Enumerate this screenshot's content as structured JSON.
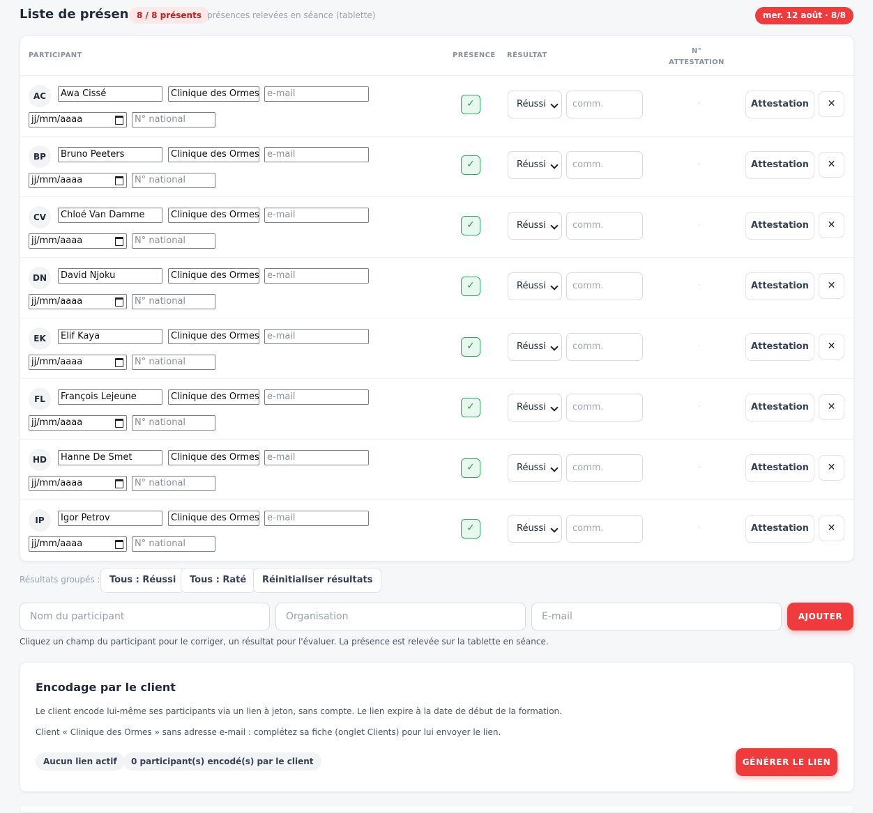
{
  "header": {
    "title": "Liste de présence",
    "count_badge": "8 / 8 présents",
    "subtitle": "présences relevées en séance (tablette)",
    "date_pill": "mer. 12 août · 8/8"
  },
  "table": {
    "columns": {
      "participant": "PARTICIPANT",
      "presence": "PRÉSENCE",
      "resultat": "RÉSULTAT",
      "attestation": "N° ATTESTATION"
    },
    "rows": [
      {
        "initials": "AC",
        "name": "Awa Cissé",
        "org": "Clinique des Ormes",
        "email_ph": "e-mail",
        "date_ph": "jj/mm/aaaa",
        "national_ph": "N° national",
        "present": "✓",
        "result": "Réussi",
        "comment_ph": "comm.",
        "attestation_no": "·",
        "attest_label": "Attestation",
        "remove": "✕"
      },
      {
        "initials": "BP",
        "name": "Bruno Peeters",
        "org": "Clinique des Ormes",
        "email_ph": "e-mail",
        "date_ph": "jj/mm/aaaa",
        "national_ph": "N° national",
        "present": "✓",
        "result": "Réussi",
        "comment_ph": "comm.",
        "attestation_no": "·",
        "attest_label": "Attestation",
        "remove": "✕"
      },
      {
        "initials": "CV",
        "name": "Chloé Van Damme",
        "org": "Clinique des Ormes",
        "email_ph": "e-mail",
        "date_ph": "jj/mm/aaaa",
        "national_ph": "N° national",
        "present": "✓",
        "result": "Réussi",
        "comment_ph": "comm.",
        "attestation_no": "·",
        "attest_label": "Attestation",
        "remove": "✕"
      },
      {
        "initials": "DN",
        "name": "David Njoku",
        "org": "Clinique des Ormes",
        "email_ph": "e-mail",
        "date_ph": "jj/mm/aaaa",
        "national_ph": "N° national",
        "present": "✓",
        "result": "Réussi",
        "comment_ph": "comm.",
        "attestation_no": "·",
        "attest_label": "Attestation",
        "remove": "✕"
      },
      {
        "initials": "EK",
        "name": "Elif Kaya",
        "org": "Clinique des Ormes",
        "email_ph": "e-mail",
        "date_ph": "jj/mm/aaaa",
        "national_ph": "N° national",
        "present": "✓",
        "result": "Réussi",
        "comment_ph": "comm.",
        "attestation_no": "·",
        "attest_label": "Attestation",
        "remove": "✕"
      },
      {
        "initials": "FL",
        "name": "François Lejeune",
        "org": "Clinique des Ormes",
        "email_ph": "e-mail",
        "date_ph": "jj/mm/aaaa",
        "national_ph": "N° national",
        "present": "✓",
        "result": "Réussi",
        "comment_ph": "comm.",
        "attestation_no": "·",
        "attest_label": "Attestation",
        "remove": "✕"
      },
      {
        "initials": "HD",
        "name": "Hanne De Smet",
        "org": "Clinique des Ormes",
        "email_ph": "e-mail",
        "date_ph": "jj/mm/aaaa",
        "national_ph": "N° national",
        "present": "✓",
        "result": "Réussi",
        "comment_ph": "comm.",
        "attestation_no": "·",
        "attest_label": "Attestation",
        "remove": "✕"
      },
      {
        "initials": "IP",
        "name": "Igor Petrov",
        "org": "Clinique des Ormes",
        "email_ph": "e-mail",
        "date_ph": "jj/mm/aaaa",
        "national_ph": "N° national",
        "present": "✓",
        "result": "Réussi",
        "comment_ph": "comm.",
        "attestation_no": "·",
        "attest_label": "Attestation",
        "remove": "✕"
      }
    ]
  },
  "grouped": {
    "label": "Résultats groupés :",
    "all_pass": "Tous : Réussi",
    "all_fail": "Tous : Raté",
    "reset": "Réinitialiser résultats"
  },
  "add_form": {
    "name_ph": "Nom du participant",
    "org_ph": "Organisation",
    "email_ph": "E-mail",
    "add_label": "AJOUTER",
    "help": "Cliquez un champ du participant pour le corriger, un résultat pour l'évaluer. La présence est relevée sur la tablette en séance."
  },
  "client": {
    "title": "Encodage par le client",
    "text1": "Le client encode lui-même ses participants via un lien à jeton, sans compte. Le lien expire à la date de début de la formation.",
    "text2": "Client « Clinique des Ormes » sans adresse e-mail : complétez sa fiche (onglet Clients) pour lui envoyer le lien.",
    "chip_link": "Aucun lien actif",
    "chip_count": "0 participant(s) encodé(s) par le client",
    "generate_label": "GÉNÉRER LE LIEN"
  },
  "colors": {
    "accent": "#ef3b3b",
    "success": "#1e9e55",
    "badge_bg": "#fde8e8"
  }
}
